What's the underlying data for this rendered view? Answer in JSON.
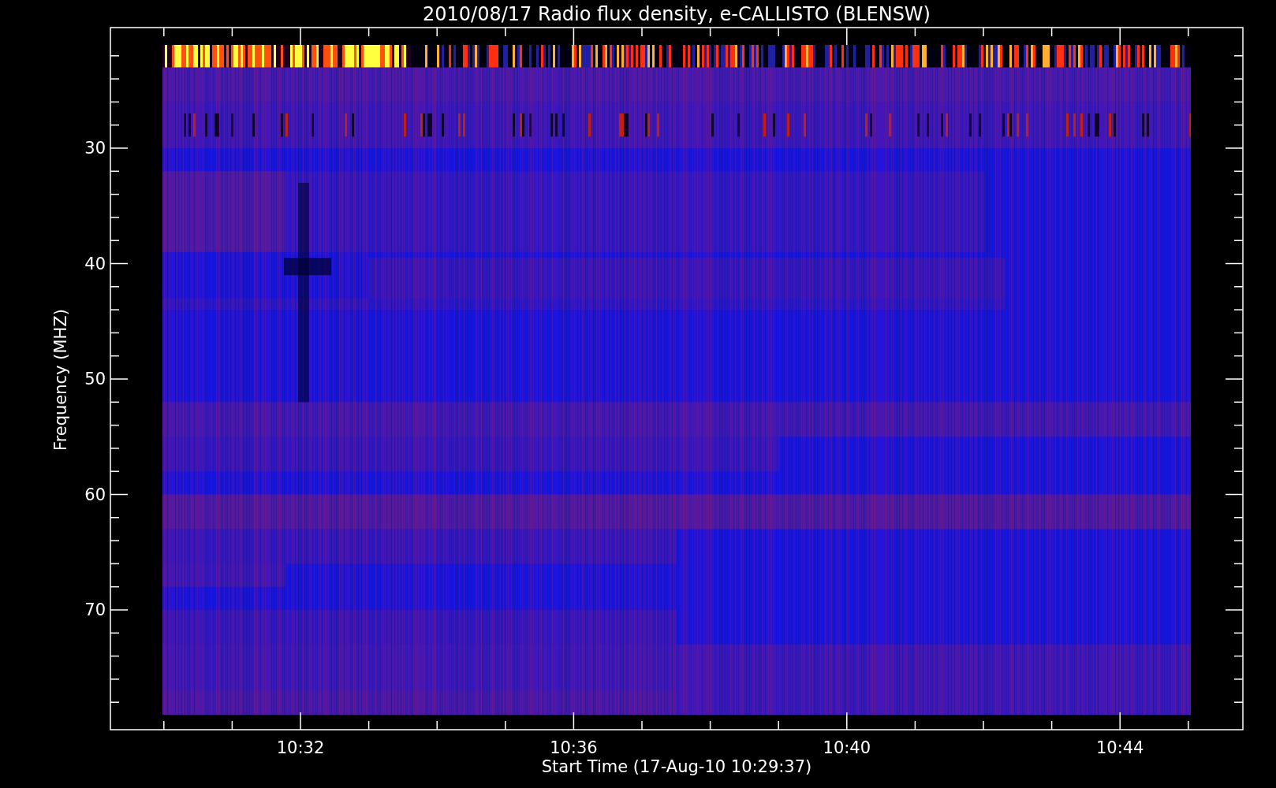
{
  "title": "2010/08/17  Radio flux density, e-CALLISTO (BLENSW)",
  "plot": {
    "ylabel": "Frequency (MHZ)",
    "xlabel": "Start Time (17-Aug-10 10:29:37)",
    "yticks": [
      "30",
      "40",
      "50",
      "60",
      "70"
    ],
    "xticks": [
      "10:32",
      "10:36",
      "10:40",
      "10:44"
    ]
  }
}
